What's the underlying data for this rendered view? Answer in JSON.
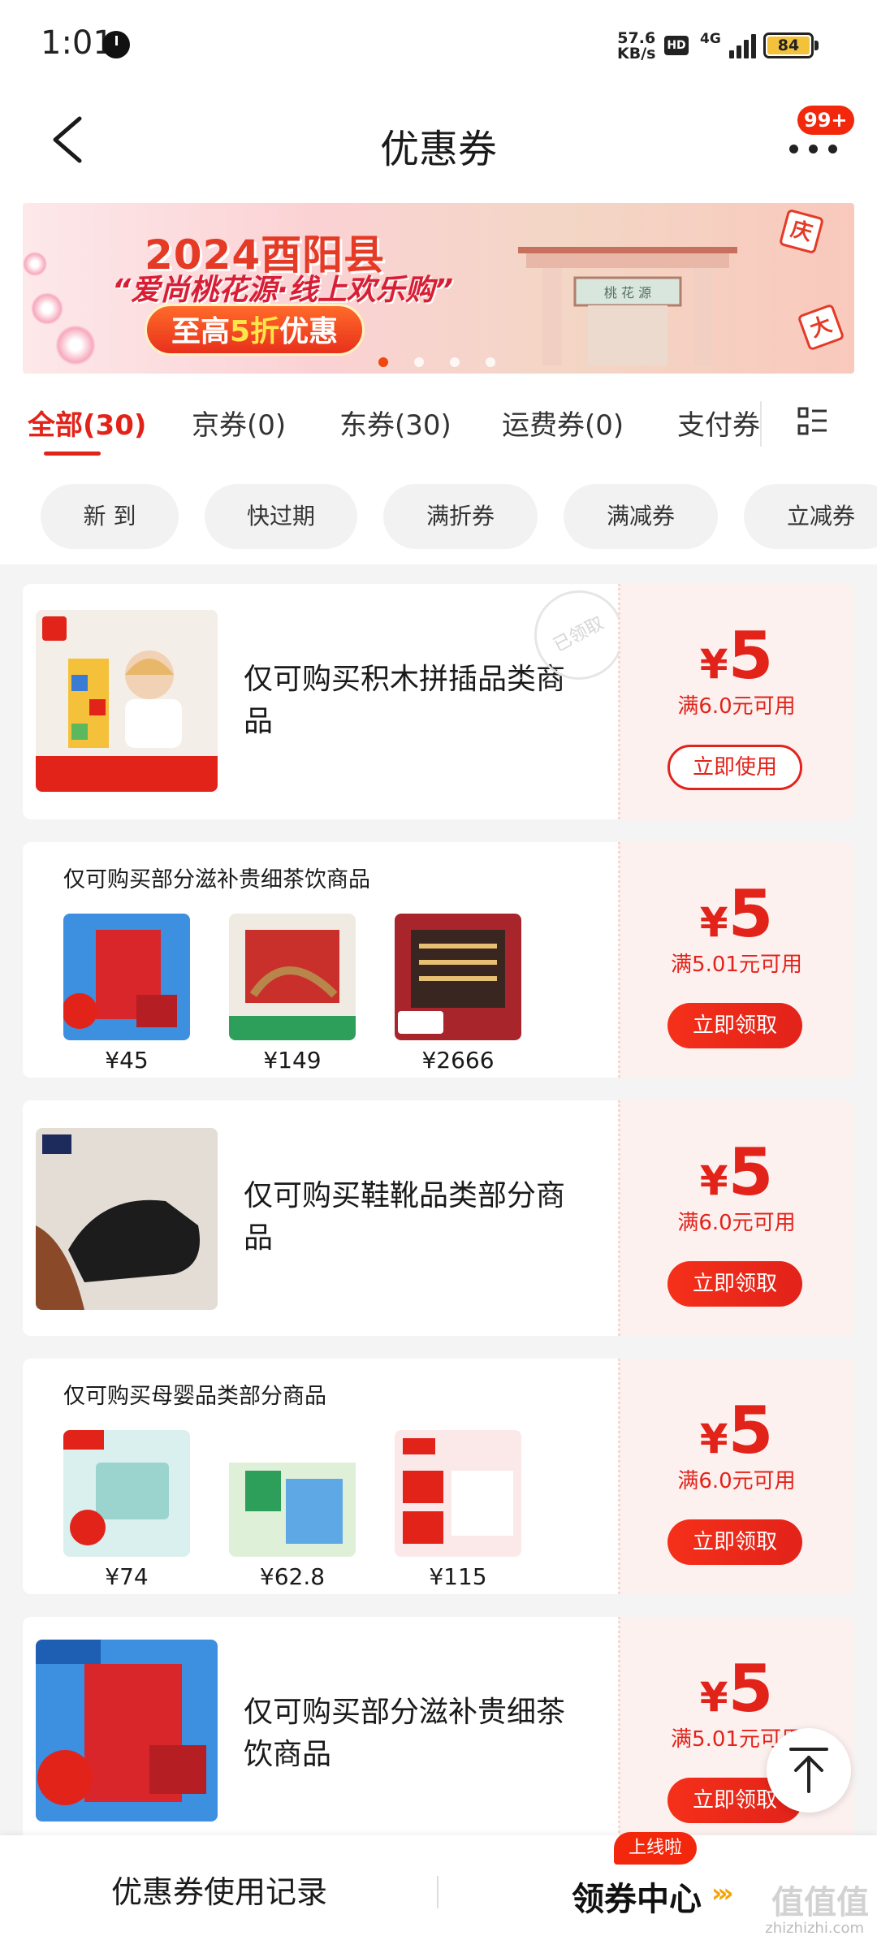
{
  "status_bar": {
    "time": "1:01",
    "net_speed": "57.6",
    "net_unit": "KB/s",
    "hd": "HD",
    "network": "4G",
    "battery": "84"
  },
  "nav": {
    "title": "优惠券",
    "badge": "99+"
  },
  "banner": {
    "line1": "2024酉阳县",
    "line2": "“爱尚桃花源·线上欢乐购”",
    "line3_prefix": "至高",
    "line3_highlight": "5折",
    "line3_suffix": "优惠",
    "gate_text": "桃 花 源",
    "flag_chars": [
      "庆",
      "大"
    ]
  },
  "tabs": [
    {
      "label": "全部(30)"
    },
    {
      "label": "京券(0)"
    },
    {
      "label": "东券(30)"
    },
    {
      "label": "运费券(0)"
    },
    {
      "label": "支付券"
    }
  ],
  "filters": [
    {
      "label": "新 到"
    },
    {
      "label": "快过期"
    },
    {
      "label": "满折券"
    },
    {
      "label": "满减券"
    },
    {
      "label": "立减券"
    }
  ],
  "coupons": [
    {
      "title": "仅可购买积木拼插品类商品",
      "stamp": "已领取",
      "currency": "¥",
      "amount": "5",
      "condition": "满6.0元可用",
      "button": "立即使用"
    },
    {
      "title": "仅可购买部分滋补贵细茶饮商品",
      "currency": "¥",
      "amount": "5",
      "condition": "满5.01元可用",
      "button": "立即领取",
      "products": [
        {
          "price": "¥45"
        },
        {
          "price": "¥149"
        },
        {
          "price": "¥2666"
        }
      ]
    },
    {
      "title": "仅可购买鞋靴品类部分商品",
      "currency": "¥",
      "amount": "5",
      "condition": "满6.0元可用",
      "button": "立即领取"
    },
    {
      "title": "仅可购买母婴品类部分商品",
      "currency": "¥",
      "amount": "5",
      "condition": "满6.0元可用",
      "button": "立即领取",
      "products": [
        {
          "price": "¥74"
        },
        {
          "price": "¥62.8"
        },
        {
          "price": "¥115"
        }
      ]
    },
    {
      "title": "仅可购买部分滋补贵细茶饮商品",
      "currency": "¥",
      "amount": "5",
      "condition": "满5.01元可用",
      "button": "立即领取"
    }
  ],
  "bottom": {
    "history": "优惠券使用记录",
    "center": "领券中心",
    "center_badge": "上线啦",
    "watermark": "值值值",
    "watermark_sub": "zhizhizhi.com"
  },
  "colors": {
    "accent": "#e2231a",
    "coupon_bg": "#fdf1f0"
  }
}
